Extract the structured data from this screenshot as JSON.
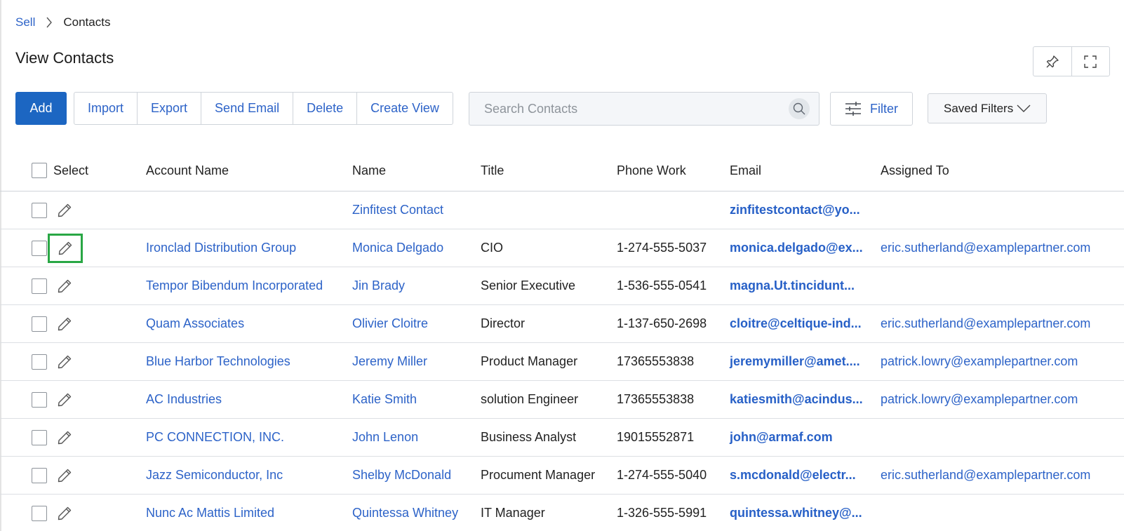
{
  "breadcrumb": {
    "parent": "Sell",
    "current": "Contacts"
  },
  "page": {
    "title": "View Contacts"
  },
  "toolbar": {
    "add": "Add",
    "import": "Import",
    "export": "Export",
    "send_email": "Send Email",
    "delete": "Delete",
    "create_view": "Create View"
  },
  "search": {
    "placeholder": "Search Contacts"
  },
  "filter": {
    "label": "Filter"
  },
  "saved_filters": {
    "label": "Saved Filters"
  },
  "table": {
    "headers": {
      "select": "Select",
      "account": "Account Name",
      "name": "Name",
      "title": "Title",
      "phone": "Phone Work",
      "email": "Email",
      "assigned": "Assigned To"
    },
    "rows": [
      {
        "account": "",
        "name": "Zinfitest Contact",
        "title": "",
        "phone": "",
        "email": "zinfitestcontact@yo...",
        "assigned": ""
      },
      {
        "account": "Ironclad Distribution Group",
        "name": "Monica Delgado",
        "title": "CIO",
        "phone": "1-274-555-5037",
        "email": "monica.delgado@ex...",
        "assigned": "eric.sutherland@examplepartner.com"
      },
      {
        "account": "Tempor Bibendum Incorporated",
        "name": "Jin Brady",
        "title": "Senior Executive",
        "phone": "1-536-555-0541",
        "email": "magna.Ut.tincidunt...",
        "assigned": ""
      },
      {
        "account": "Quam Associates",
        "name": "Olivier Cloitre",
        "title": "Director",
        "phone": "1-137-650-2698",
        "email": "cloitre@celtique-ind...",
        "assigned": "eric.sutherland@examplepartner.com"
      },
      {
        "account": "Blue Harbor Technologies",
        "name": "Jeremy Miller",
        "title": "Product Manager",
        "phone": "17365553838",
        "email": "jeremymiller@amet....",
        "assigned": "patrick.lowry@examplepartner.com"
      },
      {
        "account": "AC Industries",
        "name": "Katie Smith",
        "title": "solution Engineer",
        "phone": "17365553838",
        "email": "katiesmith@acindus...",
        "assigned": "patrick.lowry@examplepartner.com"
      },
      {
        "account": "PC CONNECTION, INC.",
        "name": "John Lenon",
        "title": "Business Analyst",
        "phone": "19015552871",
        "email": "john@armaf.com",
        "assigned": ""
      },
      {
        "account": "Jazz Semiconductor, Inc",
        "name": "Shelby McDonald",
        "title": "Procument Manager",
        "phone": "1-274-555-5040",
        "email": "s.mcdonald@electr...",
        "assigned": "eric.sutherland@examplepartner.com"
      },
      {
        "account": "Nunc Ac Mattis Limited",
        "name": "Quintessa Whitney",
        "title": "IT Manager",
        "phone": "1-326-555-5991",
        "email": "quintessa.whitney@...",
        "assigned": ""
      }
    ]
  }
}
